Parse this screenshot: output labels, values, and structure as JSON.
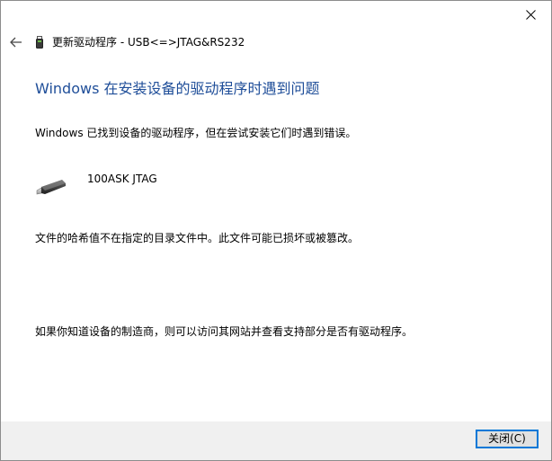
{
  "window": {
    "title": "更新驱动程序 - USB<=>JTAG&RS232"
  },
  "main": {
    "heading": "Windows 在安装设备的驱动程序时遇到问题",
    "message_found": "Windows 已找到设备的驱动程序，但在尝试安装它们时遇到错误。",
    "device_name": "100ASK JTAG",
    "message_hash": "文件的哈希值不在指定的目录文件中。此文件可能已损坏或被篡改。",
    "message_vendor": "如果你知道设备的制造商，则可以访问其网站并查看支持部分是否有驱动程序。"
  },
  "footer": {
    "close_label": "关闭(C)"
  },
  "colors": {
    "heading": "#1f4e99",
    "button_focus_border": "#0078d7",
    "footer_bg": "#f0f0f0"
  },
  "icons": {
    "back": "back-arrow-icon",
    "title_device": "usb-device-icon",
    "device": "usb-plug-icon",
    "close": "close-icon"
  }
}
